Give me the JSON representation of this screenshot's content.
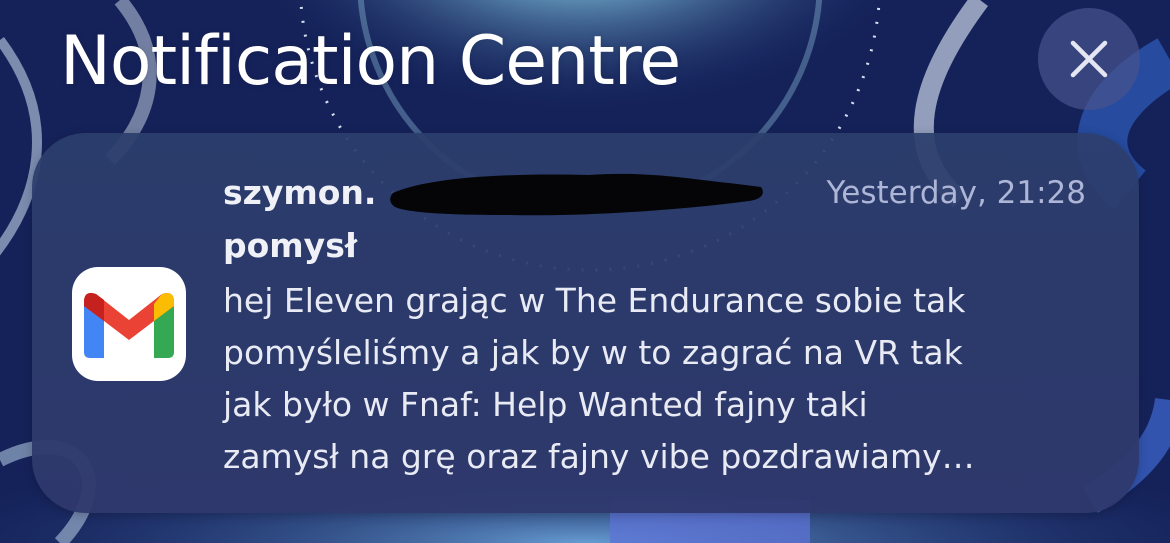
{
  "header": {
    "title": "Notification Centre",
    "close_icon": "close-icon"
  },
  "notification": {
    "app_icon": "gmail-icon",
    "sender": "szymon.",
    "timestamp": "Yesterday, 21:28",
    "subject": "pomysł",
    "body_lines": [
      "hej Eleven grając w The Endurance sobie tak",
      "pomyśleliśmy a jak by w to zagrać na VR tak",
      "jak było w Fnaf: Help Wanted fajny taki",
      "zamysł na grę oraz fajny vibe pozdrawiamy…"
    ]
  },
  "colors": {
    "gmail_red": "#EA4335",
    "gmail_blue": "#4285F4",
    "gmail_green": "#34A853",
    "gmail_yellow": "#FBBC04",
    "gmail_darkred": "#C5221F"
  }
}
